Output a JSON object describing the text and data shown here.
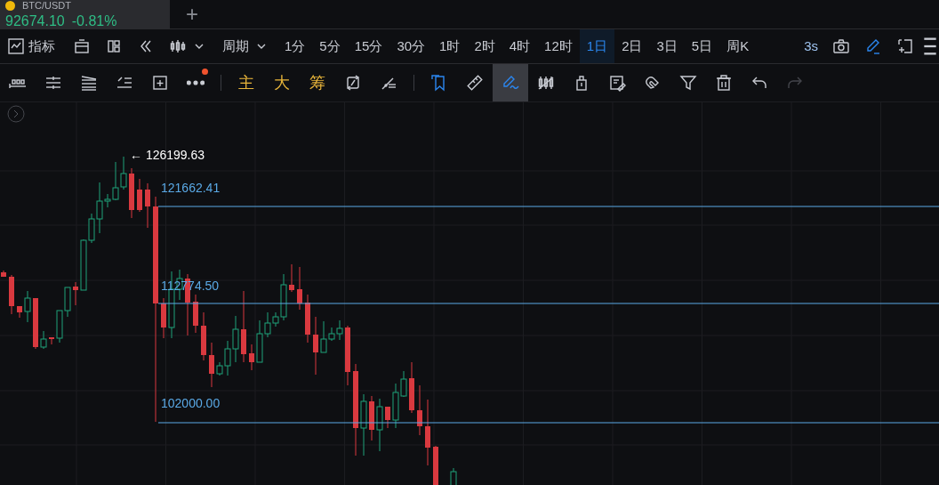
{
  "tab": {
    "title": "BTC/USDT",
    "price": "92674.10",
    "change": "-0.81%"
  },
  "new_tab": "+",
  "toolbar": {
    "indicator_label": "指标",
    "period_label": "周期",
    "refresh": "3s",
    "draw_mode_on": true,
    "intervals": [
      {
        "label": "1分",
        "selected": false
      },
      {
        "label": "5分",
        "selected": false
      },
      {
        "label": "15分",
        "selected": false
      },
      {
        "label": "30分",
        "selected": false
      },
      {
        "label": "1时",
        "selected": false
      },
      {
        "label": "2时",
        "selected": false
      },
      {
        "label": "4时",
        "selected": false
      },
      {
        "label": "12时",
        "selected": false
      },
      {
        "label": "1日",
        "selected": true
      },
      {
        "label": "2日",
        "selected": false
      },
      {
        "label": "3日",
        "selected": false
      },
      {
        "label": "5日",
        "selected": false
      },
      {
        "label": "周K",
        "selected": false
      }
    ]
  },
  "draw_bar": {
    "more_badge": true,
    "quick": [
      "主",
      "大",
      "筹"
    ],
    "tools": [
      {
        "active": true,
        "selected": false,
        "disabled": false
      },
      {
        "active": false,
        "selected": false,
        "disabled": false
      },
      {
        "active": true,
        "selected": true,
        "disabled": false
      },
      {
        "active": false,
        "selected": false,
        "disabled": false
      },
      {
        "active": false,
        "selected": false,
        "disabled": false
      },
      {
        "active": false,
        "selected": false,
        "disabled": false
      },
      {
        "active": false,
        "selected": false,
        "disabled": false
      },
      {
        "active": false,
        "selected": false,
        "disabled": false
      },
      {
        "active": false,
        "selected": false,
        "disabled": false
      },
      {
        "active": false,
        "selected": false,
        "disabled": false
      },
      {
        "active": false,
        "selected": false,
        "disabled": true
      }
    ]
  },
  "chart": {
    "peak_label": "← 126199.63",
    "levels": [
      "121662.41",
      "112774.50",
      "102000.00"
    ]
  }
}
